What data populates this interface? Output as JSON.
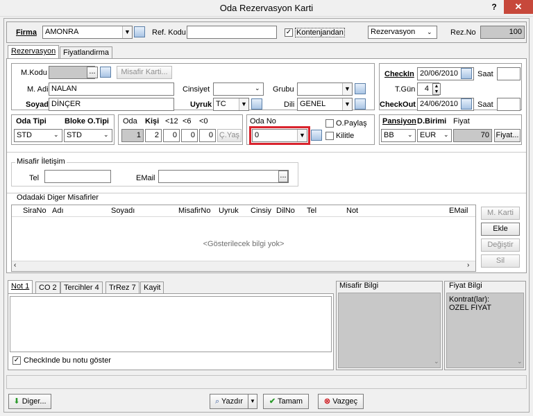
{
  "window": {
    "title": "Oda Rezervasyon Karti",
    "help": "?",
    "close": "✕"
  },
  "top": {
    "firma_label": "Firma",
    "firma_value": "AMONRA",
    "ref_kodu_label": "Ref. Kodu",
    "ref_kodu_value": "",
    "kontenjandan_label": "Kontenjandan",
    "kontenjandan_checked": true,
    "type_value": "Rezervasyon",
    "rez_no_label": "Rez.No",
    "rez_no_value": "100"
  },
  "tabs_main": [
    {
      "label": "Rezervasyon",
      "active": true
    },
    {
      "label": "Fiyatlandirma",
      "active": false
    }
  ],
  "guest": {
    "mkodu_label": "M.Kodu",
    "mkodu_value": "",
    "misafir_karti": "Misafir Karti...",
    "madi_label": "M. Adi",
    "madi_value": "NALAN",
    "soyadi_label": "Soyadi",
    "soyadi_value": "DİNÇER",
    "cinsiyet_label": "Cinsiyet",
    "cinsiyet_value": "",
    "uyruk_label": "Uyruk",
    "uyruk_value": "TC",
    "grubu_label": "Grubu",
    "grubu_value": "",
    "dili_label": "Dili",
    "dili_value": "GENEL"
  },
  "dates": {
    "checkin_label": "CheckIn",
    "checkin_value": "20/06/2010",
    "saat_label": "Saat",
    "saat1_value": "",
    "saat2_value": "",
    "tgun_label": "T.Gün",
    "tgun_value": "4",
    "checkout_label": "CheckOut",
    "checkout_value": "24/06/2010"
  },
  "room": {
    "oda_tipi_label": "Oda Tipi",
    "oda_tipi_value": "STD",
    "bloke_label": "Bloke O.Tipi",
    "bloke_value": "STD",
    "oda_label": "Oda",
    "kisi_label": "Kişi",
    "lt12_label": "<12",
    "lt6_label": "<6",
    "lt0_label": "<0",
    "oda_value": "1",
    "kisi_value": "2",
    "lt12_value": "0",
    "lt6_value": "0",
    "lt0_value": "0",
    "cyas_btn": "Ç.Yaş",
    "oda_no_label": "Oda No",
    "oda_no_value": "0",
    "opaylas_label": "O.Paylaş",
    "kilitle_label": "Kilitle"
  },
  "pricing": {
    "pansiyon_label": "Pansiyon",
    "dbirimi_label": "D.Birimi",
    "fiyat_label": "Fiyat",
    "pansiyon_value": "BB",
    "dbirimi_value": "EUR",
    "fiyat_value": "70",
    "fiyat_btn": "Fiyat..."
  },
  "contact": {
    "section_label": "Misafir İletişim",
    "tel_label": "Tel",
    "tel_value": "",
    "email_label": "EMail",
    "email_value": ""
  },
  "others": {
    "section_label": "Odadaki Diger Misafirler",
    "columns": [
      "SiraNo",
      "Adı",
      "Soyadı",
      "MisafirNo",
      "Uyruk",
      "Cinsiy",
      "DilNo",
      "Tel",
      "Not",
      "EMail"
    ],
    "empty_text": "<Gösterilecek bilgi yok>",
    "buttons": {
      "mkarti": "M. Karti",
      "ekle": "Ekle",
      "degistir": "Değiştir",
      "sil": "Sil"
    }
  },
  "notes": {
    "tabs": [
      {
        "label": "Not 1",
        "active": true
      },
      {
        "label": "CO 2",
        "active": false
      },
      {
        "label": "Tercihler 4",
        "active": false
      },
      {
        "label": "TrRez 7",
        "active": false
      },
      {
        "label": "Kayit",
        "active": false
      }
    ],
    "show_note_label": "CheckInde bu notu göster",
    "show_note_checked": true
  },
  "misafir_bilgi": {
    "label": "Misafir Bilgi"
  },
  "fiyat_bilgi": {
    "label": "Fiyat Bilgi",
    "line1": "Kontrat(lar):",
    "line2": "OZEL FIYAT"
  },
  "bottom": {
    "diger": "Diger...",
    "yazdir": "Yazdır",
    "tamam": "Tamam",
    "vazgec": "Vazgeç"
  },
  "colors": {
    "highlight_border": "#d9232d",
    "close_bg": "#c7483b",
    "readonly_gray": "#c8c8c8"
  }
}
